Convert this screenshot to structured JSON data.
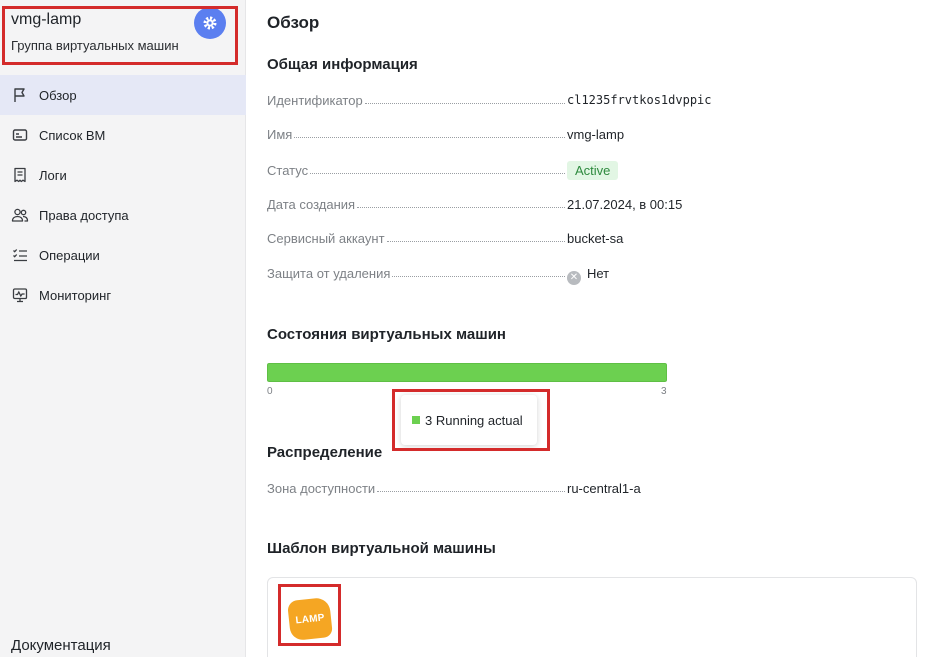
{
  "sidebar": {
    "title": "vmg-lamp",
    "subtitle": "Группа виртуальных машин",
    "settings_icon": "gear-icon",
    "items": [
      {
        "label": "Обзор",
        "icon": "flag-icon",
        "active": true
      },
      {
        "label": "Список ВМ",
        "icon": "vm-list-icon",
        "active": false
      },
      {
        "label": "Логи",
        "icon": "logs-icon",
        "active": false
      },
      {
        "label": "Права доступа",
        "icon": "users-icon",
        "active": false
      },
      {
        "label": "Операции",
        "icon": "operations-icon",
        "active": false
      },
      {
        "label": "Мониторинг",
        "icon": "monitoring-icon",
        "active": false
      }
    ],
    "footer": "Документация"
  },
  "main": {
    "title": "Обзор",
    "general": {
      "title": "Общая информация",
      "rows": [
        {
          "label": "Идентификатор",
          "value": "cl1235frvtkos1dvppic"
        },
        {
          "label": "Имя",
          "value": "vmg-lamp"
        },
        {
          "label": "Статус",
          "value": "Active"
        },
        {
          "label": "Дата создания",
          "value": "21.07.2024, в 00:15"
        },
        {
          "label": "Сервисный аккаунт",
          "value": "bucket-sa"
        },
        {
          "label": "Защита от удаления",
          "value": "Нет"
        }
      ]
    },
    "vm_states": {
      "title": "Состояния виртуальных машин",
      "axis_min": "0",
      "axis_max": "3",
      "running_count": 3,
      "total": 3,
      "tooltip_count": "3",
      "tooltip_label": "Running actual",
      "color": "#6cd050"
    },
    "distribution": {
      "title": "Распределение",
      "rows": [
        {
          "label": "Зона доступности",
          "value": "ru-central1-a"
        }
      ]
    },
    "template": {
      "title": "Шаблон виртуальной машины",
      "logo_text": "LAMP",
      "logo_color": "#f5a623"
    }
  },
  "colors": {
    "accent": "#5b7ff0",
    "highlight_box": "#d42b2b",
    "active_nav": "#e5e8f6",
    "status_bg": "#e2f6e4",
    "status_text": "#2e8a3e",
    "link": "#2d5ecb"
  }
}
